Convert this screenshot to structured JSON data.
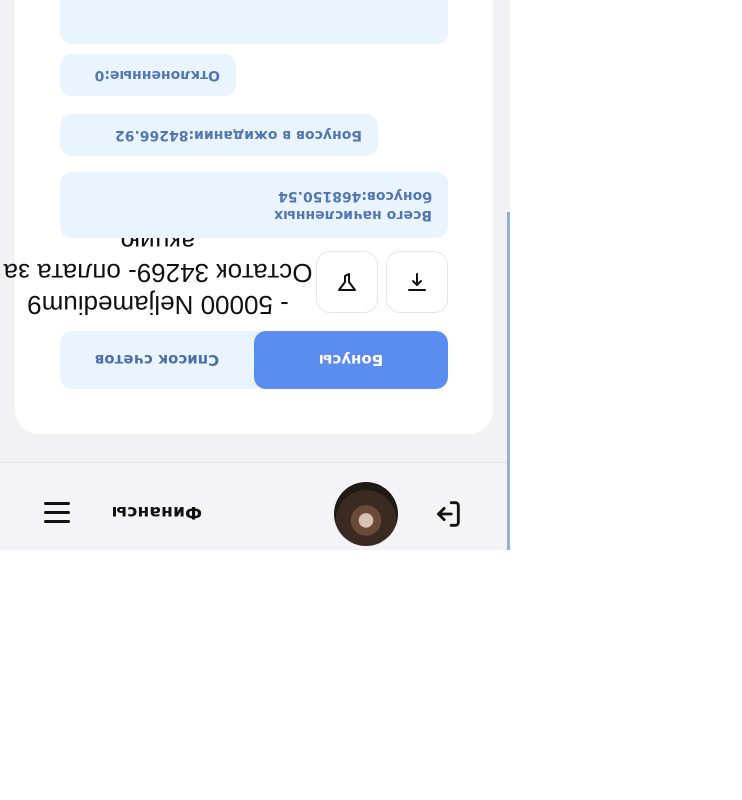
{
  "header": {
    "title": "Финансы",
    "logout_icon": "logout-icon",
    "menu_icon": "hamburger-menu-icon"
  },
  "tabs": [
    {
      "label": "Бонусы",
      "active": true
    },
    {
      "label": "Список счетов",
      "active": false
    }
  ],
  "actions": {
    "upload_icon": "upload-icon",
    "filter_icon": "filter-icon"
  },
  "caption": "- 50000 Neljamedium9 Остаток 34269- оплата за акцию",
  "stats": {
    "total_line1": "Всего начисленных",
    "total_line2": "бонусов:468150.54",
    "pending": "Бонусов в ожидании:84266.92",
    "rejected": "Отклоненные:0"
  },
  "colors": {
    "accent": "#5b8cf0",
    "chip_bg": "#eaf4ff",
    "chip_text": "#5277b3"
  }
}
